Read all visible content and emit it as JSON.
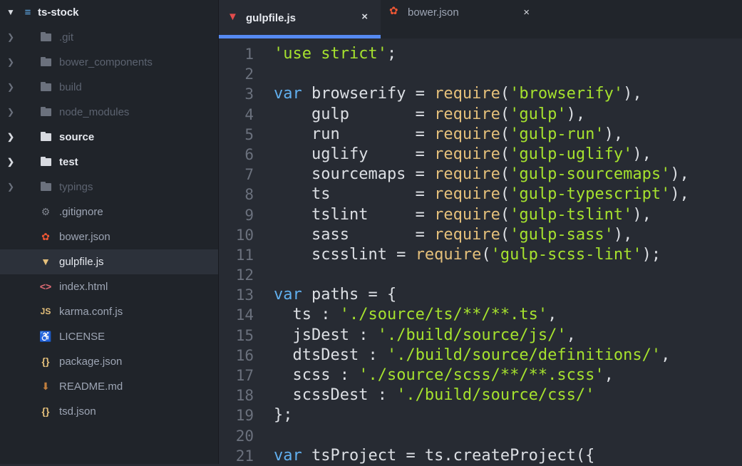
{
  "sidebar": {
    "root": {
      "name": "ts-stock",
      "icon": "repository-icon"
    },
    "items": [
      {
        "name": ".git",
        "type": "folder",
        "state": "muted"
      },
      {
        "name": "bower_components",
        "type": "folder",
        "state": "muted"
      },
      {
        "name": "build",
        "type": "folder",
        "state": "muted"
      },
      {
        "name": "node_modules",
        "type": "folder",
        "state": "muted"
      },
      {
        "name": "source",
        "type": "folder",
        "state": "bold"
      },
      {
        "name": "test",
        "type": "folder",
        "state": "bold"
      },
      {
        "name": "typings",
        "type": "folder",
        "state": "muted"
      },
      {
        "name": ".gitignore",
        "type": "file",
        "icon": "gear-icon"
      },
      {
        "name": "bower.json",
        "type": "file",
        "icon": "bower-icon"
      },
      {
        "name": "gulpfile.js",
        "type": "file",
        "icon": "gulp-icon",
        "selected": true
      },
      {
        "name": "index.html",
        "type": "file",
        "icon": "html-code-icon"
      },
      {
        "name": "karma.conf.js",
        "type": "file",
        "icon": "javascript-icon"
      },
      {
        "name": "LICENSE",
        "type": "file",
        "icon": "license-icon"
      },
      {
        "name": "package.json",
        "type": "file",
        "icon": "json-braces-icon"
      },
      {
        "name": "README.md",
        "type": "file",
        "icon": "markdown-icon"
      },
      {
        "name": "tsd.json",
        "type": "file",
        "icon": "json-braces-icon"
      }
    ]
  },
  "tabs": [
    {
      "label": "gulpfile.js",
      "icon": "gulp-icon",
      "active": true,
      "close": "×"
    },
    {
      "label": "bower.json",
      "icon": "bower-icon",
      "active": false,
      "close": "×"
    }
  ],
  "colors": {
    "sidebar_bg": "#20242a",
    "editor_bg": "#272b33",
    "accent": "#568af2",
    "keyword": "#61afef",
    "function": "#e5c07b",
    "string": "#a6e22e"
  },
  "code_lines": [
    {
      "n": "1",
      "t": [
        [
          "str",
          "'use strict'"
        ],
        [
          "op",
          ";"
        ]
      ]
    },
    {
      "n": "2",
      "t": []
    },
    {
      "n": "3",
      "t": [
        [
          "kw",
          "var"
        ],
        [
          "op",
          " browserify = "
        ],
        [
          "fn",
          "require"
        ],
        [
          "op",
          "("
        ],
        [
          "str",
          "'browserify'"
        ],
        [
          "op",
          "),"
        ]
      ]
    },
    {
      "n": "4",
      "t": [
        [
          "op",
          "    gulp       = "
        ],
        [
          "fn",
          "require"
        ],
        [
          "op",
          "("
        ],
        [
          "str",
          "'gulp'"
        ],
        [
          "op",
          "),"
        ]
      ]
    },
    {
      "n": "5",
      "t": [
        [
          "op",
          "    run        = "
        ],
        [
          "fn",
          "require"
        ],
        [
          "op",
          "("
        ],
        [
          "str",
          "'gulp-run'"
        ],
        [
          "op",
          "),"
        ]
      ]
    },
    {
      "n": "6",
      "t": [
        [
          "op",
          "    uglify     = "
        ],
        [
          "fn",
          "require"
        ],
        [
          "op",
          "("
        ],
        [
          "str",
          "'gulp-uglify'"
        ],
        [
          "op",
          "),"
        ]
      ]
    },
    {
      "n": "7",
      "t": [
        [
          "op",
          "    sourcemaps = "
        ],
        [
          "fn",
          "require"
        ],
        [
          "op",
          "("
        ],
        [
          "str",
          "'gulp-sourcemaps'"
        ],
        [
          "op",
          "),"
        ]
      ]
    },
    {
      "n": "8",
      "t": [
        [
          "op",
          "    ts         = "
        ],
        [
          "fn",
          "require"
        ],
        [
          "op",
          "("
        ],
        [
          "str",
          "'gulp-typescript'"
        ],
        [
          "op",
          "),"
        ]
      ]
    },
    {
      "n": "9",
      "t": [
        [
          "op",
          "    tslint     = "
        ],
        [
          "fn",
          "require"
        ],
        [
          "op",
          "("
        ],
        [
          "str",
          "'gulp-tslint'"
        ],
        [
          "op",
          "),"
        ]
      ]
    },
    {
      "n": "10",
      "t": [
        [
          "op",
          "    sass       = "
        ],
        [
          "fn",
          "require"
        ],
        [
          "op",
          "("
        ],
        [
          "str",
          "'gulp-sass'"
        ],
        [
          "op",
          "),"
        ]
      ]
    },
    {
      "n": "11",
      "t": [
        [
          "op",
          "    scsslint = "
        ],
        [
          "fn",
          "require"
        ],
        [
          "op",
          "("
        ],
        [
          "str",
          "'gulp-scss-lint'"
        ],
        [
          "op",
          ");"
        ]
      ]
    },
    {
      "n": "12",
      "t": []
    },
    {
      "n": "13",
      "t": [
        [
          "kw",
          "var"
        ],
        [
          "op",
          " paths = {"
        ]
      ]
    },
    {
      "n": "14",
      "t": [
        [
          "op",
          "  ts : "
        ],
        [
          "str",
          "'./source/ts/**/**.ts'"
        ],
        [
          "op",
          ","
        ]
      ]
    },
    {
      "n": "15",
      "t": [
        [
          "op",
          "  jsDest : "
        ],
        [
          "str",
          "'./build/source/js/'"
        ],
        [
          "op",
          ","
        ]
      ]
    },
    {
      "n": "16",
      "t": [
        [
          "op",
          "  dtsDest : "
        ],
        [
          "str",
          "'./build/source/definitions/'"
        ],
        [
          "op",
          ","
        ]
      ]
    },
    {
      "n": "17",
      "t": [
        [
          "op",
          "  scss : "
        ],
        [
          "str",
          "'./source/scss/**/**.scss'"
        ],
        [
          "op",
          ","
        ]
      ]
    },
    {
      "n": "18",
      "t": [
        [
          "op",
          "  scssDest : "
        ],
        [
          "str",
          "'./build/source/css/'"
        ]
      ]
    },
    {
      "n": "19",
      "t": [
        [
          "op",
          "};"
        ]
      ]
    },
    {
      "n": "20",
      "t": []
    },
    {
      "n": "21",
      "t": [
        [
          "kw",
          "var"
        ],
        [
          "op",
          " tsProject = ts.createProject({"
        ]
      ]
    }
  ]
}
